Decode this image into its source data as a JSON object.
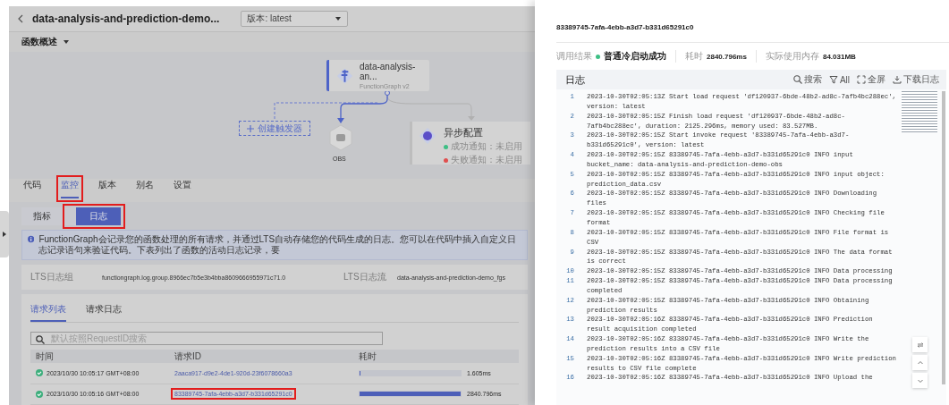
{
  "header": {
    "title": "data-analysis-and-prediction-demo...",
    "version_select": {
      "value": "版本: latest"
    }
  },
  "overview_menu": {
    "label": "函数概述"
  },
  "diagram": {
    "function_node": {
      "name": "data-analysis-an...",
      "subtitle": "FunctionGraph v2"
    },
    "trigger_button": {
      "label": "创建触发器"
    },
    "trigger_nodes": [
      {
        "label": "OBS"
      }
    ],
    "async_config": {
      "title": "异步配置",
      "items": [
        {
          "label": "成功通知：未启用",
          "color": "#3dbf84"
        },
        {
          "label": "失败通知：未启用",
          "color": "#e04f4f"
        }
      ]
    }
  },
  "tabs": [
    {
      "label": "代码",
      "selected": false,
      "highlighted": false
    },
    {
      "label": "监控",
      "selected": true,
      "highlighted": true
    },
    {
      "label": "版本",
      "selected": false,
      "highlighted": false
    },
    {
      "label": "别名",
      "selected": false,
      "highlighted": false
    },
    {
      "label": "设置",
      "selected": false,
      "highlighted": false
    }
  ],
  "monitor_tabs": [
    {
      "label": "指标",
      "selected": false,
      "highlighted": false
    },
    {
      "label": "日志",
      "selected": true,
      "highlighted": true
    }
  ],
  "info_banner": "FunctionGraph会记录您的函数处理的所有请求，并通过LTS自动存储您的代码生成的日志。您可以在代码中插入自定义日志记录语句来验证代码。下表列出了函数的活动日志记录，要",
  "lts": {
    "group_label": "LTS日志组",
    "group": "functiongraph.log.group.8966ec7b5e3b4bba8609666955971c71.0",
    "stream_label": "LTS日志流",
    "stream": "data-analysis-and-prediction-demo_fgs"
  },
  "requests": {
    "tabs": [
      {
        "label": "请求列表",
        "selected": true
      },
      {
        "label": "请求日志",
        "selected": false
      }
    ],
    "search": {
      "placeholder": "默认按照RequestID搜索"
    },
    "columns": [
      "时间",
      "请求ID",
      "耗时"
    ],
    "rows": [
      {
        "kind": "success",
        "time": "2023/10/30 10:05:17 GMT+08:00",
        "request_id": "2aaca917-d9e2-4de1-920d-23f6078660a3",
        "level": 0.006,
        "duration": "1.605ms",
        "highlighted": false
      },
      {
        "kind": "success",
        "time": "2023/10/30 10:05:16 GMT+08:00",
        "request_id": "83389745-7afa-4ebb-a3d7-b331d65291c0",
        "level": 1,
        "duration": "2840.796ms",
        "highlighted": true
      }
    ]
  },
  "drawer": {
    "title": "83389745-7afa-4ebb-a3d7-b331d65291c0",
    "stats": [
      {
        "label": "调用结果",
        "value": "普通冷启动成功",
        "kind": "success"
      },
      {
        "label": "耗时",
        "value": "2840.796ms"
      },
      {
        "label": "实际使用内存",
        "value": "84.031MB"
      }
    ],
    "log": {
      "title": "日志",
      "tools": [
        {
          "kind": "search",
          "label": "搜索"
        },
        {
          "kind": "filter",
          "label": "All"
        },
        {
          "kind": "fullscreen",
          "label": "全屏"
        },
        {
          "kind": "download",
          "label": "下载日志"
        }
      ],
      "lines": [
        {
          "number": "1",
          "text": "2023-10-30T02:05:13Z Start load request 'df120937-6bde-48b2-ad8c-7afb4bc288ec', version: latest"
        },
        {
          "number": "2",
          "text": "2023-10-30T02:05:15Z Finish load request 'df120937-6bde-48b2-ad8c-7afb4bc288ec', duration: 2125.296ms, memory used: 83.527MB."
        },
        {
          "number": "3",
          "text": "2023-10-30T02:05:15Z Start invoke request '83389745-7afa-4ebb-a3d7-b331d65291c0', version: latest"
        },
        {
          "number": "4",
          "text": "2023-10-30T02:05:15Z 83389745-7afa-4ebb-a3d7-b331d65291c0 INFO input bucket_name: data-analysis-and-prediction-demo-obs"
        },
        {
          "number": "5",
          "text": "2023-10-30T02:05:15Z 83389745-7afa-4ebb-a3d7-b331d65291c0 INFO input object: prediction_data.csv"
        },
        {
          "number": "6",
          "text": "2023-10-30T02:05:15Z 83389745-7afa-4ebb-a3d7-b331d65291c0 INFO Downloading files"
        },
        {
          "number": "7",
          "text": "2023-10-30T02:05:15Z 83389745-7afa-4ebb-a3d7-b331d65291c0 INFO Checking file format"
        },
        {
          "number": "8",
          "text": "2023-10-30T02:05:15Z 83389745-7afa-4ebb-a3d7-b331d65291c0 INFO File format is CSV"
        },
        {
          "number": "9",
          "text": "2023-10-30T02:05:15Z 83389745-7afa-4ebb-a3d7-b331d65291c0 INFO The data format is correct"
        },
        {
          "number": "10",
          "text": "2023-10-30T02:05:15Z 83389745-7afa-4ebb-a3d7-b331d65291c0 INFO Data processing"
        },
        {
          "number": "11",
          "text": "2023-10-30T02:05:15Z 83389745-7afa-4ebb-a3d7-b331d65291c0 INFO Data processing completed"
        },
        {
          "number": "12",
          "text": "2023-10-30T02:05:15Z 83389745-7afa-4ebb-a3d7-b331d65291c0 INFO Obtaining prediction results"
        },
        {
          "number": "13",
          "text": "2023-10-30T02:05:16Z 83389745-7afa-4ebb-a3d7-b331d65291c0 INFO Prediction result acquisition completed"
        },
        {
          "number": "14",
          "text": "2023-10-30T02:05:16Z 83389745-7afa-4ebb-a3d7-b331d65291c0 INFO Write the prediction results into a CSV file"
        },
        {
          "number": "15",
          "text": "2023-10-30T02:05:16Z 83389745-7afa-4ebb-a3d7-b331d65291c0 INFO Write prediction results to CSV file complete"
        },
        {
          "number": "16",
          "text": "2023-10-30T02:05:16Z 83389745-7afa-4ebb-a3d7-b331d65291c0 INFO Upload the"
        }
      ]
    }
  }
}
